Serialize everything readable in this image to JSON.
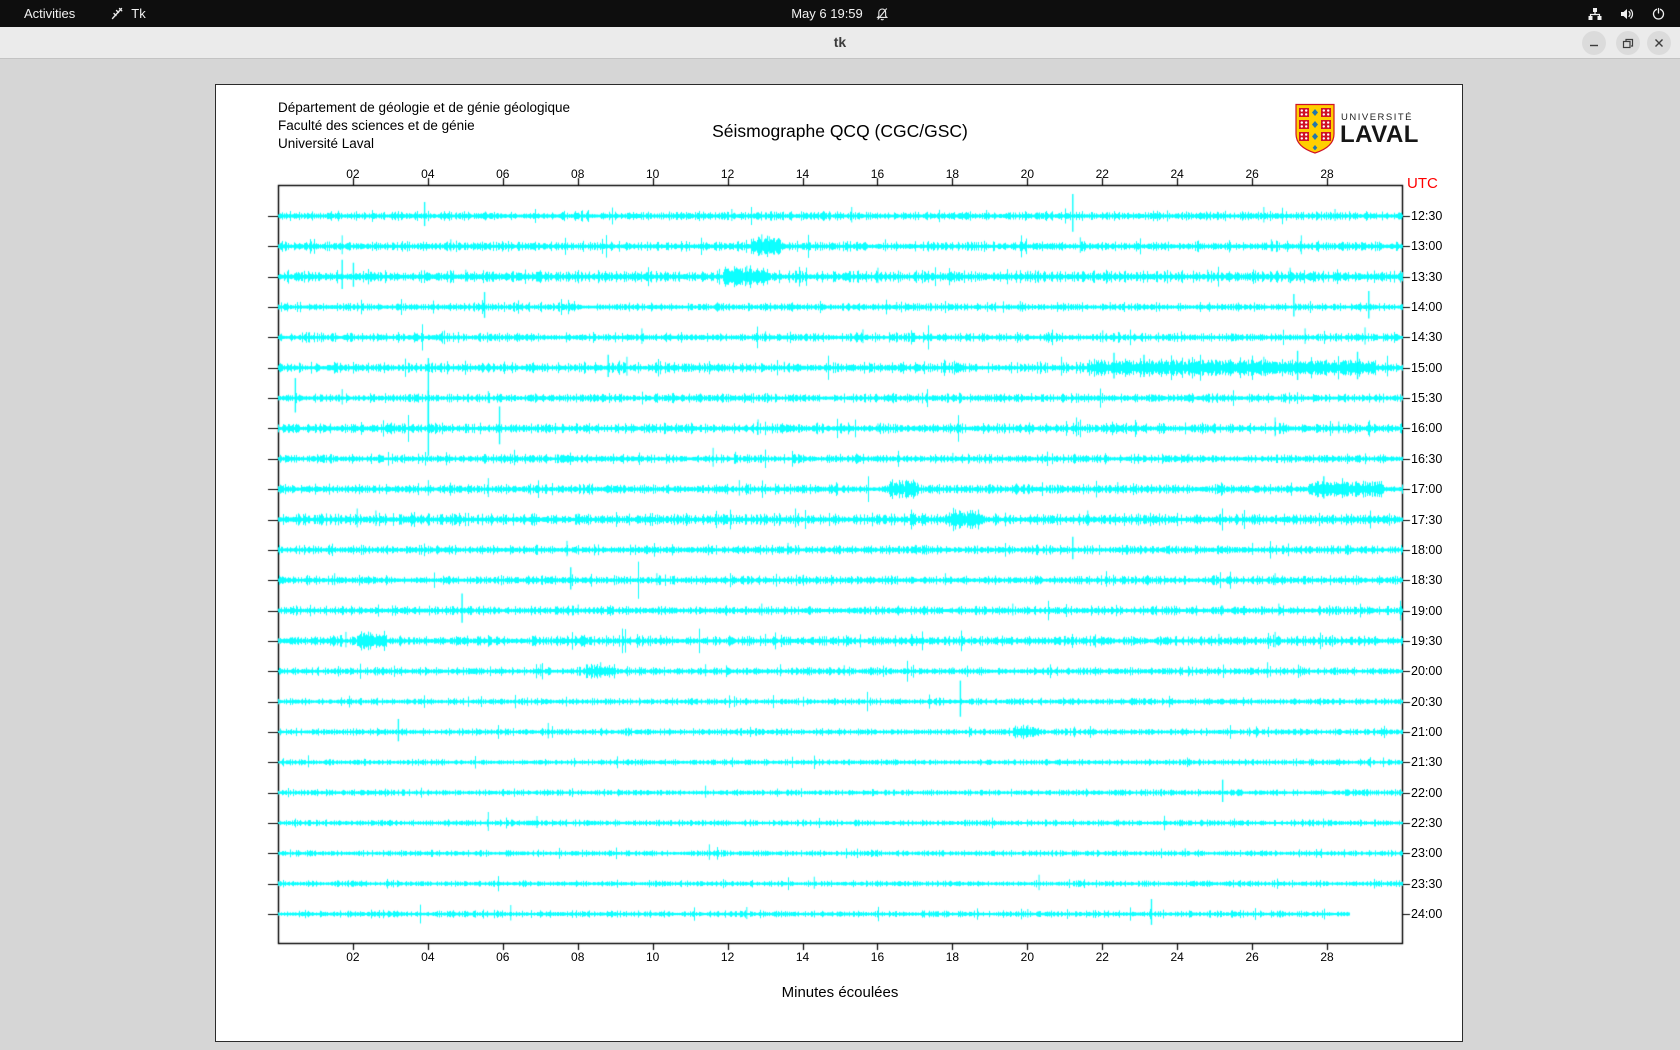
{
  "top_bar": {
    "activities_label": "Activities",
    "app_menu_label": "Tk",
    "app_menu_icon": "tk-feather-icon",
    "clock": "May 6 19:59",
    "notification_icon": "bell-muted-icon",
    "status_icons": [
      "network-wired-icon",
      "volume-icon",
      "power-icon"
    ]
  },
  "title_bar": {
    "title": "tk",
    "controls": [
      "minimize",
      "maximize",
      "close"
    ]
  },
  "window": {
    "header_lines": [
      "Département de géologie et de génie géologique",
      "Faculté des sciences et de génie",
      "Université Laval"
    ],
    "logo": {
      "line1": "UNIVERSITÉ",
      "line2": "LAVAL"
    }
  },
  "colors": {
    "trace": "#00ffff",
    "utc_red": "#ff0000",
    "axis": "#000000"
  },
  "chart_data": {
    "type": "line",
    "subtype": "helicorder-seismogram",
    "title": "Séismographe QCQ (CGC/GSC)",
    "xlabel": "Minutes écoulées",
    "utc_label": "UTC",
    "x_range_minutes": [
      0,
      30
    ],
    "x_ticks": [
      {
        "minute": 2,
        "label": "02"
      },
      {
        "minute": 4,
        "label": "04"
      },
      {
        "minute": 6,
        "label": "06"
      },
      {
        "minute": 8,
        "label": "08"
      },
      {
        "minute": 10,
        "label": "10"
      },
      {
        "minute": 12,
        "label": "12"
      },
      {
        "minute": 14,
        "label": "14"
      },
      {
        "minute": 16,
        "label": "16"
      },
      {
        "minute": 18,
        "label": "18"
      },
      {
        "minute": 20,
        "label": "20"
      },
      {
        "minute": 22,
        "label": "22"
      },
      {
        "minute": 24,
        "label": "24"
      },
      {
        "minute": 26,
        "label": "26"
      },
      {
        "minute": 28,
        "label": "28"
      }
    ],
    "grid": false,
    "legend": "none",
    "rows": [
      {
        "time": "12:30",
        "noise": 3.0,
        "end": 30,
        "spikes": [
          [
            3.9,
            14
          ],
          [
            12.1,
            7
          ],
          [
            15.3,
            9
          ],
          [
            18.9,
            6
          ],
          [
            21.2,
            22
          ],
          [
            26.3,
            9
          ],
          [
            28.2,
            7
          ]
        ],
        "bursts": []
      },
      {
        "time": "13:00",
        "noise": 3.2,
        "end": 30,
        "spikes": [
          [
            1.7,
            11
          ],
          [
            4.6,
            7
          ],
          [
            12.9,
            12
          ],
          [
            13.1,
            10
          ],
          [
            16.2,
            7
          ],
          [
            21.4,
            9
          ],
          [
            26.5,
            7
          ],
          [
            27.3,
            11
          ]
        ],
        "bursts": [
          [
            12.6,
            13.4,
            5
          ]
        ]
      },
      {
        "time": "13:30",
        "noise": 4.0,
        "end": 30,
        "spikes": [
          [
            1.7,
            17
          ],
          [
            2.0,
            14
          ],
          [
            5.0,
            7
          ],
          [
            12.5,
            11
          ],
          [
            16.0,
            9
          ],
          [
            20.0,
            6
          ],
          [
            24.8,
            7
          ],
          [
            27.0,
            9
          ]
        ],
        "bursts": [
          [
            11.9,
            13.1,
            5
          ]
        ]
      },
      {
        "time": "14:00",
        "noise": 2.6,
        "end": 30,
        "spikes": [
          [
            5.5,
            15
          ],
          [
            7.9,
            6
          ],
          [
            16.5,
            5
          ],
          [
            19.8,
            6
          ],
          [
            22.2,
            5
          ],
          [
            27.1,
            13
          ],
          [
            29.1,
            16
          ]
        ],
        "bursts": []
      },
      {
        "time": "14:30",
        "noise": 2.8,
        "end": 30,
        "spikes": [
          [
            9.7,
            9
          ],
          [
            13.0,
            6
          ],
          [
            15.6,
            8
          ],
          [
            22.0,
            7
          ],
          [
            24.1,
            6
          ],
          [
            27.4,
            9
          ],
          [
            29.0,
            10
          ]
        ],
        "bursts": []
      },
      {
        "time": "15:00",
        "noise": 3.2,
        "end": 30,
        "spikes": [
          [
            8.8,
            13
          ],
          [
            9.3,
            11
          ],
          [
            13.5,
            6
          ],
          [
            17.8,
            7
          ],
          [
            20.9,
            11
          ],
          [
            22.3,
            15
          ],
          [
            23.1,
            13
          ],
          [
            24.3,
            9
          ],
          [
            25.4,
            8
          ],
          [
            26.3,
            11
          ],
          [
            27.2,
            17
          ],
          [
            28.8,
            16
          ],
          [
            29.6,
            12
          ]
        ],
        "bursts": [
          [
            21.6,
            29.3,
            4
          ]
        ]
      },
      {
        "time": "15:30",
        "noise": 2.8,
        "end": 30,
        "spikes": [
          [
            0.45,
            20
          ],
          [
            1.7,
            9
          ],
          [
            4.0,
            40
          ],
          [
            5.6,
            7
          ],
          [
            13.0,
            5
          ],
          [
            20.1,
            5
          ],
          [
            24.0,
            4
          ]
        ],
        "bursts": []
      },
      {
        "time": "16:00",
        "noise": 3.2,
        "end": 30,
        "spikes": [
          [
            4.0,
            38
          ],
          [
            5.9,
            22
          ],
          [
            12.8,
            9
          ],
          [
            16.0,
            5
          ],
          [
            21.3,
            11
          ],
          [
            26.6,
            11
          ],
          [
            28.3,
            7
          ]
        ],
        "bursts": []
      },
      {
        "time": "16:30",
        "noise": 2.8,
        "end": 30,
        "spikes": [
          [
            6.3,
            9
          ],
          [
            11.6,
            11
          ],
          [
            12.2,
            7
          ],
          [
            15.0,
            5
          ],
          [
            18.0,
            6
          ],
          [
            24.3,
            5
          ]
        ],
        "bursts": []
      },
      {
        "time": "17:00",
        "noise": 3.2,
        "end": 30,
        "spikes": [
          [
            4.0,
            9
          ],
          [
            5.6,
            11
          ],
          [
            12.3,
            9
          ],
          [
            16.6,
            7
          ],
          [
            19.0,
            5
          ],
          [
            22.4,
            7
          ],
          [
            27.9,
            13
          ],
          [
            28.4,
            11
          ]
        ],
        "bursts": [
          [
            16.3,
            17.1,
            4
          ],
          [
            27.5,
            29.5,
            4
          ]
        ]
      },
      {
        "time": "17:30",
        "noise": 3.8,
        "end": 30,
        "spikes": [
          [
            2.1,
            11
          ],
          [
            2.6,
            9
          ],
          [
            8.0,
            6
          ],
          [
            13.8,
            11
          ],
          [
            18.3,
            7
          ],
          [
            21.6,
            9
          ],
          [
            24.5,
            5
          ]
        ],
        "bursts": [
          [
            17.9,
            18.8,
            4
          ]
        ]
      },
      {
        "time": "18:00",
        "noise": 2.9,
        "end": 30,
        "spikes": [
          [
            7.7,
            9
          ],
          [
            13.6,
            7
          ],
          [
            17.0,
            5
          ],
          [
            21.2,
            13
          ],
          [
            26.0,
            7
          ]
        ],
        "bursts": []
      },
      {
        "time": "18:30",
        "noise": 2.9,
        "end": 30,
        "spikes": [
          [
            1.5,
            7
          ],
          [
            7.8,
            13
          ],
          [
            10.1,
            7
          ],
          [
            14.0,
            5
          ],
          [
            17.8,
            7
          ],
          [
            22.1,
            9
          ],
          [
            26.6,
            7
          ]
        ],
        "bursts": []
      },
      {
        "time": "19:00",
        "noise": 2.9,
        "end": 30,
        "spikes": [
          [
            4.9,
            17
          ],
          [
            8.0,
            6
          ],
          [
            12.9,
            7
          ],
          [
            19.6,
            7
          ],
          [
            25.2,
            5
          ],
          [
            26.7,
            7
          ]
        ],
        "bursts": []
      },
      {
        "time": "19:30",
        "noise": 3.2,
        "end": 30,
        "spikes": [
          [
            1.8,
            9
          ],
          [
            2.5,
            7
          ],
          [
            10.2,
            6
          ],
          [
            13.0,
            7
          ],
          [
            16.9,
            7
          ],
          [
            21.0,
            5
          ],
          [
            25.1,
            7
          ],
          [
            26.6,
            9
          ]
        ],
        "bursts": [
          [
            2.1,
            2.9,
            4
          ]
        ]
      },
      {
        "time": "20:00",
        "noise": 2.5,
        "end": 30,
        "spikes": [
          [
            7.0,
            7
          ],
          [
            8.6,
            9
          ],
          [
            11.4,
            7
          ],
          [
            13.4,
            7
          ],
          [
            15.1,
            6
          ],
          [
            18.0,
            4
          ],
          [
            26.4,
            9
          ]
        ],
        "bursts": [
          [
            8.2,
            9.0,
            3
          ]
        ]
      },
      {
        "time": "20:30",
        "noise": 2.1,
        "end": 30,
        "spikes": [
          [
            18.2,
            21
          ]
        ],
        "bursts": []
      },
      {
        "time": "21:00",
        "noise": 2.1,
        "end": 30,
        "spikes": [
          [
            3.2,
            13
          ],
          [
            7.2,
            9
          ],
          [
            20.0,
            7
          ]
        ],
        "bursts": [
          [
            19.6,
            20.3,
            3
          ]
        ]
      },
      {
        "time": "21:30",
        "noise": 1.9,
        "end": 30,
        "spikes": [
          [
            0.8,
            7
          ]
        ],
        "bursts": []
      },
      {
        "time": "22:00",
        "noise": 1.9,
        "end": 30,
        "spikes": [
          [
            11.4,
            7
          ],
          [
            25.2,
            13
          ]
        ],
        "bursts": []
      },
      {
        "time": "22:30",
        "noise": 1.9,
        "end": 30,
        "spikes": [
          [
            5.6,
            11
          ],
          [
            6.9,
            7
          ]
        ],
        "bursts": []
      },
      {
        "time": "23:00",
        "noise": 1.9,
        "end": 30,
        "spikes": [
          [
            11.5,
            9
          ],
          [
            24.2,
            5
          ]
        ],
        "bursts": []
      },
      {
        "time": "23:30",
        "noise": 1.9,
        "end": 30,
        "spikes": [
          [
            14.3,
            7
          ],
          [
            20.3,
            9
          ]
        ],
        "bursts": []
      },
      {
        "time": "24:00",
        "noise": 2.1,
        "end": 28.6,
        "spikes": [
          [
            6.2,
            9
          ],
          [
            12.5,
            7
          ],
          [
            20.0,
            5
          ],
          [
            23.3,
            15
          ]
        ],
        "bursts": []
      }
    ]
  }
}
